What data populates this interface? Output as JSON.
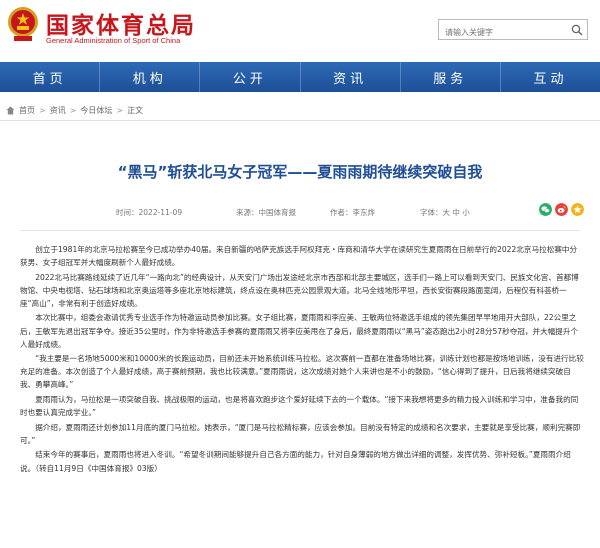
{
  "header": {
    "title": "国家体育总局",
    "subtitle": "General Administration of Sport of China",
    "search_placeholder": "请输入关键字"
  },
  "nav": {
    "items": [
      "首页",
      "机构",
      "公开",
      "资讯",
      "服务",
      "互动"
    ]
  },
  "breadcrumb": {
    "items": [
      "首页",
      "资讯",
      "今日体坛",
      "正文"
    ]
  },
  "article": {
    "title": "“黑马”斩获北马女子冠军——夏雨雨期待继续突破自我",
    "meta": {
      "time": "时间：2022-11-09",
      "source": "来源：中国体育报",
      "author": "作者：李东烨",
      "font": "字体：大 中 小"
    },
    "paragraphs": [
      "创立于1981年的北京马拉松赛至今已成功举办40届。来自新疆的哈萨克族选手阿权拜克・库商和清华大学在读研究生夏雨雨在日前举行的2022北京马拉松赛中分获男、女子组冠军并大幅度刷新个人最好成绩。",
      "2022北马比赛路线延续了近几年“一路向北”的经典设计，从天安门广场出发途经北京市西部和北部主要城区，选手们一路上可以看到天安门、民族文化宫、首都博物馆、中央电视塔、钻石球场和北京奥运塔等多座北京地标建筑，终点设在奥林匹克公园景观大道。北马全线地形平坦，西长安街赛段路面宽阔，后程仅有科荟桥一座“高山”，非常有利于创造好成绩。",
      "本次比赛中，组委会邀请优秀专业选手作为特邀运动员参加比赛。女子组比赛，夏雨雨和李应美、王敏两位特邀选手组成的领先集团早早地用开大部队，22公里之后，王敏军先退出冠军争夺。接近35公里时，作为非特邀选手参赛的夏雨雨又将李应美甩在了身后，最终夏雨雨以“黑马”姿态跑出2小时28分57秒夺冠，并大幅提升个人最好成绩。",
      "“我主要是一名场地5000米和10000米的长跑运动员，目前还未开始系统训练马拉松。这次赛前一直都在准备场地比赛，训练计划也都是按场地训练，没有进行比较充足的准备。本次创造了个人最好成绩，高于赛前预期，我也比较满意。”夏雨雨说，这次成绩对她个人来讲也是不小的鼓励，“信心得到了提升，日后我将继续突破自我、勇攀高峰。”",
      "夏雨雨认为，马拉松是一项突破自我、挑战极限的运动，也是将喜欢跑步这个爱好延续下去的一个载体。“接下来我想将更多的精力投入训练和学习中，准备我的同时也要认真完成学业。”",
      "据介绍，夏雨雨还计划参加11月底的厦门马拉松。她表示，“厦门是马拉松精标赛，应该会参加。目前没有特定的成绩和名次要求，主要就是享受比赛，顺利完赛即可。”",
      "结束今年的赛事后，夏雨雨也将进入冬训。“希望冬训期间能够提升自己各方面的能力，针对自身薄弱的地方做出详细的调整，发挥优势、弥补短板。”夏雨雨介绍说。（转自11月9日《中国体育报》03版）"
    ]
  },
  "colors": {
    "brand_red": "#c8161d",
    "nav_blue": "#1d4f98",
    "title_blue": "#1f4e96",
    "share_green": "#2aae67",
    "share_red": "#e64340"
  }
}
